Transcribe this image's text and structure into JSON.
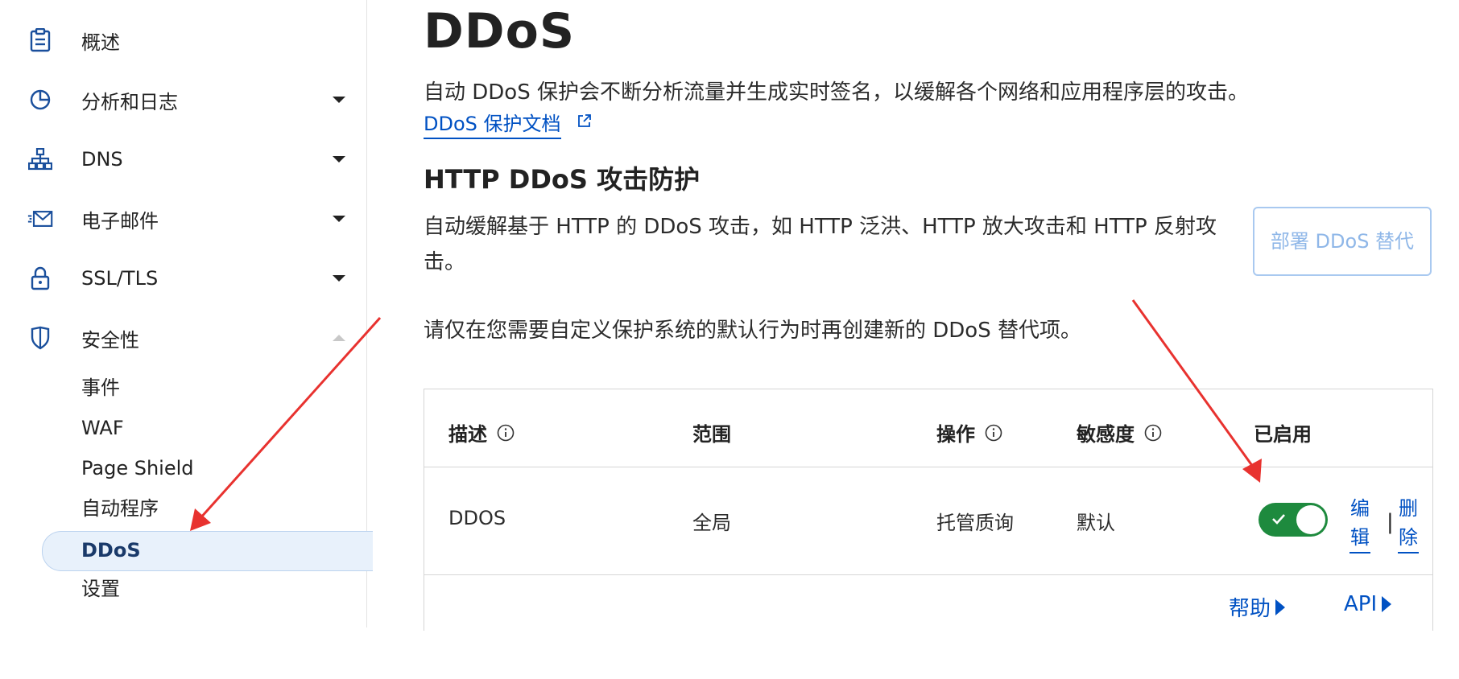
{
  "sidebar": {
    "items": [
      {
        "label": "概述",
        "icon": "clipboard-icon"
      },
      {
        "label": "分析和日志",
        "icon": "pie-chart-icon"
      },
      {
        "label": "DNS",
        "icon": "network-icon"
      },
      {
        "label": "电子邮件",
        "icon": "email-icon"
      },
      {
        "label": "SSL/TLS",
        "icon": "lock-icon"
      },
      {
        "label": "安全性",
        "icon": "shield-icon"
      }
    ],
    "security_subitems": [
      "事件",
      "WAF",
      "Page Shield",
      "自动程序",
      "DDoS",
      "设置"
    ]
  },
  "page": {
    "title": "DDoS",
    "description": "自动 DDoS 保护会不断分析流量并生成实时签名，以缓解各个网络和应用程序层的攻击。",
    "doc_link": "DDoS 保护文档",
    "section_title": "HTTP DDoS 攻击防护",
    "section_desc": "自动缓解基于 HTTP 的 DDoS 攻击，如 HTTP 泛洪、HTTP 放大攻击和 HTTP 反射攻击。",
    "deploy_button": "部署 DDoS 替代",
    "notice": "请仅在您需要自定义保护系统的默认行为时再创建新的 DDoS 替代项。"
  },
  "table": {
    "headers": {
      "description": "描述",
      "scope": "范围",
      "action": "操作",
      "sensitivity": "敏感度",
      "enabled": "已启用"
    },
    "rows": [
      {
        "description": "DDOS",
        "scope": "全局",
        "action": "托管质询",
        "sensitivity": "默认",
        "enabled": true,
        "edit": "编辑",
        "delete": "删除",
        "separator": "|"
      }
    ],
    "footer": {
      "help": "帮助",
      "api": "API"
    }
  },
  "colors": {
    "accent": "#0051c3",
    "toggle_on": "#1e8a3e",
    "annotation_arrow": "#e8322f",
    "active_bg": "#e8f1fb"
  }
}
